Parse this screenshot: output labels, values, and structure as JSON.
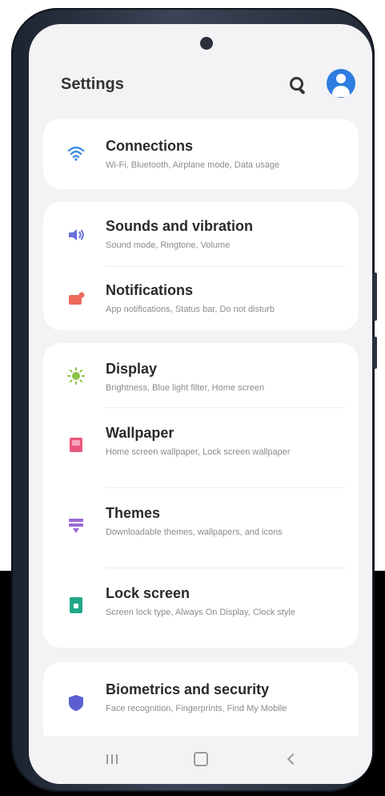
{
  "header": {
    "title": "Settings",
    "search_icon": "search-icon",
    "account_icon": "account-icon"
  },
  "colors": {
    "accent": "#2e7de0",
    "connections": "#3d8fe3",
    "sounds": "#6670d8",
    "notifications": "#ec6b5d",
    "display": "#8bc34a",
    "wallpaper": "#e9577e",
    "themes": "#9a6ad6",
    "lock": "#1fa886",
    "security": "#5c5fd1"
  },
  "settings": {
    "connections": {
      "icon": "wifi-icon",
      "label": "Connections",
      "sub": "Wi-Fi, Bluetooth, Airplane mode, Data usage"
    },
    "sounds": {
      "icon": "speaker-icon",
      "label": "Sounds and vibration",
      "sub": "Sound mode, Ringtone, Volume"
    },
    "notifications": {
      "icon": "notification-icon",
      "label": "Notifications",
      "sub": "App notifications, Status bar, Do not disturb"
    },
    "display": {
      "icon": "brightness-icon",
      "label": "Display",
      "sub": "Brightness, Blue light filter, Home screen"
    },
    "wallpaper": {
      "icon": "wallpaper-icon",
      "label": "Wallpaper",
      "sub": "Home screen wallpaper, Lock screen wallpaper"
    },
    "themes": {
      "icon": "themes-icon",
      "label": "Themes",
      "sub": "Downloadable themes, wallpapers, and icons"
    },
    "lock": {
      "icon": "lock-screen-icon",
      "label": "Lock screen",
      "sub": "Screen lock type, Always On Display, Clock style"
    },
    "security": {
      "icon": "shield-icon",
      "label": "Biometrics and security",
      "sub": "Face recognition, Fingerprints, Find My Mobile"
    }
  },
  "navbar": {
    "recent_icon": "recent-apps-icon",
    "home_icon": "home-icon",
    "back_icon": "back-icon"
  }
}
